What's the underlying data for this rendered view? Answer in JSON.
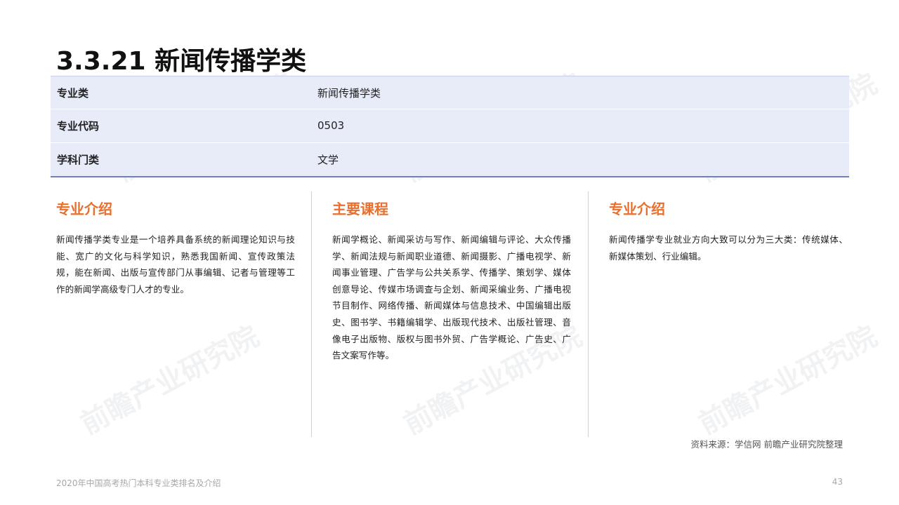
{
  "title": "3.3.21 新闻传播学类",
  "info_rows": [
    {
      "key": "专业类",
      "value": "新闻传播学类"
    },
    {
      "key": "专业代码",
      "value": "0503"
    },
    {
      "key": "学科门类",
      "value": "文学"
    }
  ],
  "columns": [
    {
      "heading": "专业介绍",
      "text": "新闻传播学类专业是一个培养具备系统的新闻理论知识与技能、宽广的文化与科学知识，熟悉我国新闻、宣传政策法规，能在新闻、出版与宣传部门从事编辑、记者与管理等工作的新闻学高级专门人才的专业。"
    },
    {
      "heading": "主要课程",
      "text": "新闻学概论、新闻采访与写作、新闻编辑与评论、大众传播学、新闻法规与新闻职业道德、新闻摄影、广播电视学、新闻事业管理、广告学与公共关系学、传播学、策划学、媒体创意导论、传媒市场调查与企划、新闻采编业务、广播电视节目制作、网络传播、新闻媒体与信息技术、中国编辑出版史、图书学、书籍编辑学、出版现代技术、出版社管理、音像电子出版物、版权与图书外贸、广告学概论、广告史、广告文案写作等。"
    },
    {
      "heading": "专业介绍",
      "text": "新闻传播学专业就业方向大致可以分为三大类：传统媒体、新媒体策划、行业编辑。"
    }
  ],
  "source": "资料来源：学信网 前瞻产业研究院整理",
  "footer": {
    "left": "2020年中国高考热门本科专业类排名及介绍",
    "page_number": "43"
  },
  "watermark": "前瞻产业研究院",
  "colors": {
    "accent": "#e86f2e",
    "table_bg": "#e8ebf8",
    "table_border": "#6f7fc1"
  }
}
